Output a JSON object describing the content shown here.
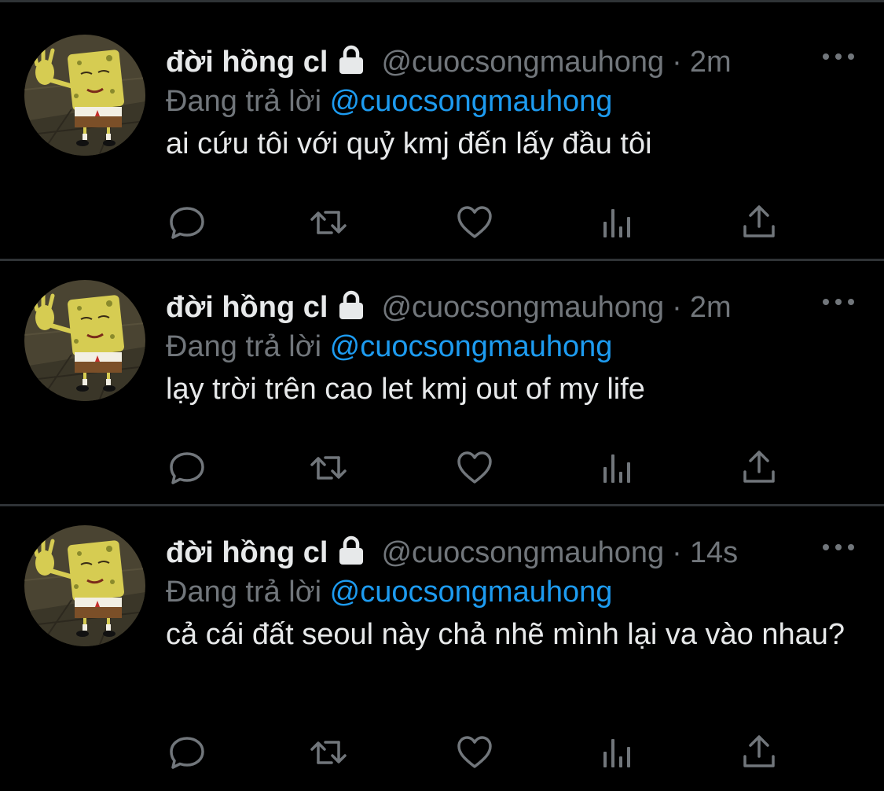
{
  "colors": {
    "background": "#000000",
    "divider": "#2f3336",
    "text_primary": "#e7e9ea",
    "text_secondary": "#71767b",
    "accent": "#1d9bf0"
  },
  "tweets": [
    {
      "display_name": "đời hồng cl",
      "handle": "@cuocsongmauhong",
      "separator": "·",
      "time": "2m",
      "reply_prefix": "Đang trả lời",
      "reply_mention": "@cuocsongmauhong",
      "text": "ai cứu tôi với quỷ kmj đến lấy đầu tôi",
      "icons": {
        "avatar": "spongebob-avatar",
        "lock": "lock-icon",
        "more": "more-options-icon",
        "actions": [
          "reply-icon",
          "retweet-icon",
          "like-icon",
          "analytics-icon",
          "share-icon"
        ]
      }
    },
    {
      "display_name": "đời hồng cl",
      "handle": "@cuocsongmauhong",
      "separator": "·",
      "time": "2m",
      "reply_prefix": "Đang trả lời",
      "reply_mention": "@cuocsongmauhong",
      "text": "lạy trời trên cao let kmj out of my life",
      "icons": {
        "avatar": "spongebob-avatar",
        "lock": "lock-icon",
        "more": "more-options-icon",
        "actions": [
          "reply-icon",
          "retweet-icon",
          "like-icon",
          "analytics-icon",
          "share-icon"
        ]
      }
    },
    {
      "display_name": "đời hồng cl",
      "handle": "@cuocsongmauhong",
      "separator": "·",
      "time": "14s",
      "reply_prefix": "Đang trả lời",
      "reply_mention": "@cuocsongmauhong",
      "text": "cả cái đất seoul này chả nhẽ mình lại va vào nhau?",
      "icons": {
        "avatar": "spongebob-avatar",
        "lock": "lock-icon",
        "more": "more-options-icon",
        "actions": [
          "reply-icon",
          "retweet-icon",
          "like-icon",
          "analytics-icon",
          "share-icon"
        ]
      }
    }
  ]
}
